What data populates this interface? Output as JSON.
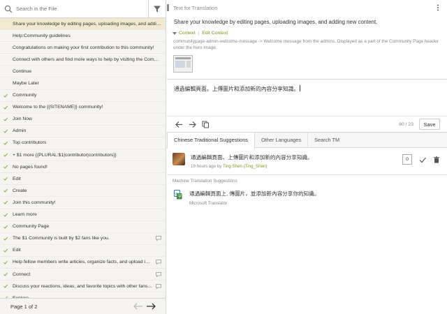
{
  "search": {
    "placeholder": "Search in the File"
  },
  "colors": {
    "translated": "#7db240",
    "selected_row": "#f2e9d0",
    "link": "#7b9a1b"
  },
  "items": [
    {
      "text": "Share your knowledge by editing pages, uploading images, and adding...",
      "status": "translated",
      "selected": true,
      "comment": false
    },
    {
      "text": "Help:Community guidelines",
      "status": "translated",
      "selected": false,
      "comment": false
    },
    {
      "text": "Congratulations on making your first contribution to this community!",
      "status": "translated",
      "selected": false,
      "comment": false
    },
    {
      "text": "Connect with others and find more ways to help by visiting the Commu...",
      "status": "translated",
      "selected": false,
      "comment": false
    },
    {
      "text": "Continue",
      "status": "translated",
      "selected": false,
      "comment": false
    },
    {
      "text": "Maybe Later",
      "status": "translated",
      "selected": false,
      "comment": false
    },
    {
      "text": "Community",
      "status": "approved",
      "selected": false,
      "comment": false
    },
    {
      "text": "Welcome to the {{SITENAME}} community!",
      "status": "approved",
      "selected": false,
      "comment": false
    },
    {
      "text": "Join Now",
      "status": "approved",
      "selected": false,
      "comment": false
    },
    {
      "text": "Admin",
      "status": "approved",
      "selected": false,
      "comment": false
    },
    {
      "text": "Top contributors",
      "status": "approved",
      "selected": false,
      "comment": false
    },
    {
      "text": "+ $1 more {{PLURAL:$1|contributor|contributors}}",
      "status": "approved",
      "selected": false,
      "comment": false
    },
    {
      "text": "No pages found!",
      "status": "approved",
      "selected": false,
      "comment": false
    },
    {
      "text": "Edit",
      "status": "approved",
      "selected": false,
      "comment": false
    },
    {
      "text": "Create",
      "status": "approved",
      "selected": false,
      "comment": false
    },
    {
      "text": "Join this community!",
      "status": "approved",
      "selected": false,
      "comment": false
    },
    {
      "text": "Learn more",
      "status": "approved",
      "selected": false,
      "comment": false
    },
    {
      "text": "Community Page",
      "status": "approved",
      "selected": false,
      "comment": false
    },
    {
      "text": "The $1 Community is built by $2 fans like you.",
      "status": "approved",
      "selected": false,
      "comment": true
    },
    {
      "text": "Edit",
      "status": "approved",
      "selected": false,
      "comment": false
    },
    {
      "text": "Help fellow members write articles, organize facts, and upload ima...",
      "status": "approved",
      "selected": false,
      "comment": true
    },
    {
      "text": "Connect",
      "status": "approved",
      "selected": false,
      "comment": true
    },
    {
      "text": "Discuss your reactions, ideas, and favorite topics with other fans w...",
      "status": "approved",
      "selected": false,
      "comment": true
    },
    {
      "text": "Explore",
      "status": "approved",
      "selected": false,
      "comment": false
    }
  ],
  "pager": {
    "label": "Page 1 of 2"
  },
  "source": {
    "header": "Text for Translation",
    "text": "Share your knowledge by editing pages, uploading images, and adding new content.",
    "context_label": "Context",
    "edit_context_label": "Edit Context",
    "context_description": "communitypage-admin-welcome-message -> Welcome message from the admins. Displayed as a part of the Community Page header under the hero image."
  },
  "editor": {
    "value": "通過編輯頁面。上傳圖片和添加新的內容分享知識。",
    "count": "80 / 23",
    "save_label": "Save"
  },
  "tabs": [
    "Chinese Traditional Suggestions",
    "Other Languages",
    "Search TM"
  ],
  "suggestion": {
    "text": "通過編輯頁面、上傳圖片和添加新的內容分享知識。",
    "time": "19 hours ago by",
    "user": "Ting Shen (Ting_Shen)",
    "votes": "0"
  },
  "mt": {
    "header": "Machine Translation Suggestions",
    "text": "通過編輯頁面上, 傳圖片，並添加新內容分享你的知識。",
    "engine": "Microsoft Translator"
  }
}
